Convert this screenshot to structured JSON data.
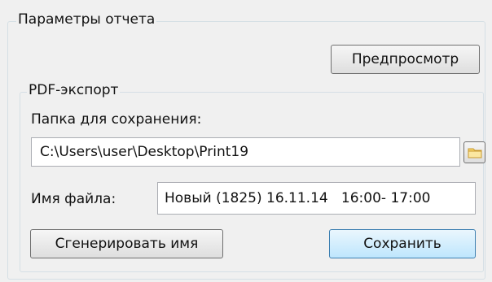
{
  "report_settings": {
    "title": "Параметры отчета",
    "preview_label": "Предпросмотр"
  },
  "pdf_export": {
    "title": "PDF-экспорт",
    "folder_label": "Папка для сохранения:",
    "folder_value": "C:\\Users\\user\\Desktop\\Print19",
    "browse_icon": "folder-icon",
    "filename_label": "Имя файла:",
    "filename_value": "Новый (1825) 16.11.14   16:00- 17:00",
    "generate_label": "Сгенерировать имя",
    "save_label": "Сохранить"
  },
  "colors": {
    "background": "#f0f0f0",
    "group_border": "#d5dfe5",
    "button_border": "#707070",
    "save_button_border": "#3c7fb1",
    "save_button_fill": "#bee6fd",
    "folder_icon": "#e8b84a"
  }
}
